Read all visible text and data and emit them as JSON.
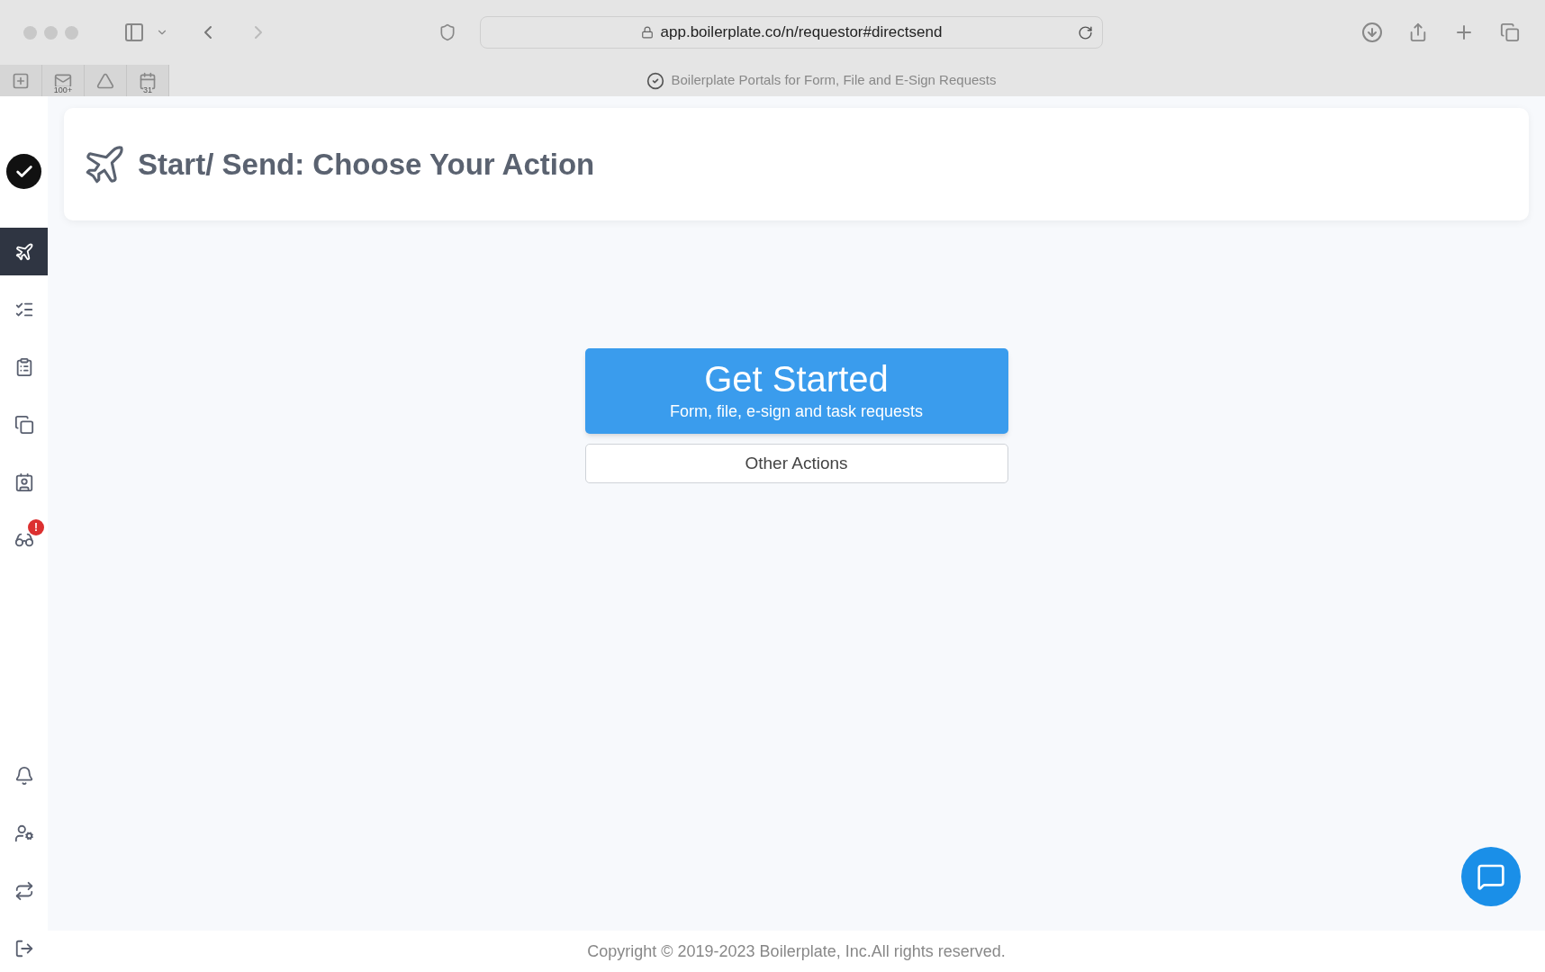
{
  "browser": {
    "url": "app.boilerplate.co/n/requestor#directsend",
    "tab_title": "Boilerplate Portals for Form, File and E-Sign Requests",
    "bookmarks": [
      {
        "kind": "plus"
      },
      {
        "kind": "mail",
        "badge": "100+"
      },
      {
        "kind": "drive"
      },
      {
        "kind": "calendar",
        "badge": "31"
      }
    ]
  },
  "sidebar": {
    "items": [
      {
        "selected": true
      },
      {
        "selected": false
      },
      {
        "selected": false
      },
      {
        "selected": false
      },
      {
        "selected": false
      },
      {
        "selected": false,
        "badge": "!"
      }
    ],
    "bottom_items": [
      {
        "selected": false
      },
      {
        "selected": false
      },
      {
        "selected": false
      },
      {
        "selected": false
      }
    ]
  },
  "header": {
    "title": "Start/ Send: Choose Your Action"
  },
  "primary_action": {
    "label": "Get Started",
    "sublabel": "Form, file, e-sign and task requests"
  },
  "secondary_action": {
    "label": "Other Actions"
  },
  "footer": {
    "text": "Copyright © 2019-2023 Boilerplate, Inc.All rights reserved."
  }
}
